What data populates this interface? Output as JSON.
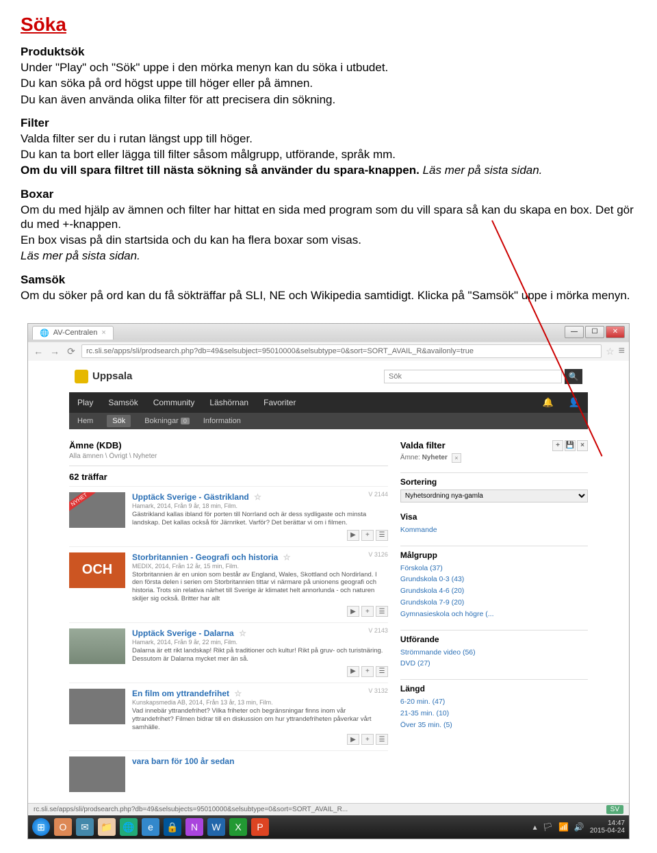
{
  "doc": {
    "title": "Söka",
    "s1": {
      "h": "Produktsök",
      "p1": "Under \"Play\" och \"Sök\" uppe i den mörka menyn kan du söka i utbudet.",
      "p2": "Du kan söka på ord högst uppe till höger eller på ämnen.",
      "p3": "Du kan även använda olika filter för att precisera din sökning."
    },
    "s2": {
      "h": "Filter",
      "p1": "Valda filter ser du i rutan längst upp till höger.",
      "p2": "Du kan ta bort eller lägga till filter såsom målgrupp, utförande, språk mm.",
      "p3bold": "Om du vill spara filtret till nästa sökning så använder du spara-knappen.",
      "p3italic": " Läs mer på sista sidan."
    },
    "s3": {
      "h": "Boxar",
      "p1": "Om du med hjälp av ämnen och filter har hittat en sida med program som du vill spara så kan du skapa en box. Det gör du med +-knappen.",
      "p2": "En box visas på din startsida och du kan ha flera boxar som visas.",
      "p3italic": "Läs mer på sista sidan."
    },
    "s4": {
      "h": "Samsök",
      "p1": "Om du söker på ord kan du få sökträffar på SLI, NE och Wikipedia samtidigt. Klicka på \"Samsök\" uppe i mörka menyn."
    }
  },
  "browser": {
    "tabTitle": "AV-Centralen",
    "url": "rc.sli.se/apps/sli/prodsearch.php?db=49&selsubject=95010000&selsubtype=0&sort=SORT_AVAIL_R&availonly=true"
  },
  "site": {
    "logo": "Uppsala",
    "searchPlaceholder": "Sök",
    "navMain": [
      "Play",
      "Samsök",
      "Community",
      "Läshörnan",
      "Favoriter"
    ],
    "navSub": {
      "hem": "Hem",
      "sok": "Sök",
      "bokningar": "Bokningar",
      "bokCount": "0",
      "info": "Information"
    },
    "left": {
      "panelTitle": "Ämne (KDB)",
      "crumb": "Alla ämnen \\ Övrigt \\ Nyheter",
      "hits": "62 träffar"
    },
    "results": [
      {
        "title": "Upptäck Sverige - Gästrikland",
        "meta": "Hamark, 2014, Från 9 år, 18 min, Film.",
        "desc": "Gästrikland kallas ibland för porten till Norrland och är dess sydligaste och minsta landskap. Det kallas också för Järnriket. Varför? Det berättar vi om i filmen.",
        "id": "V 2144",
        "nyhet": true,
        "thumbClass": ""
      },
      {
        "title": "Storbritannien - Geografi och historia",
        "meta": "MEDIX, 2014, Från 12 år, 15 min, Film.",
        "desc": "Storbritannien är en union som består av England, Wales, Skottland och Nordirland. I den första delen i serien om Storbritannien tittar vi närmare på unionens geografi och historia. Trots sin relativa närhet till Sverige är klimatet helt annorlunda - och naturen skiljer sig också. Britter har allt",
        "id": "V 3126",
        "thumbClass": "och",
        "thumbText": "OCH"
      },
      {
        "title": "Upptäck Sverige - Dalarna",
        "meta": "Hamark, 2014, Från 9 år, 22 min, Film.",
        "desc": "Dalarna är ett rikt landskap! Rikt på traditioner och kultur! Rikt på gruv- och turistnäring. Dessutom är Dalarna mycket mer än så.",
        "id": "V 2143",
        "thumbClass": "gray"
      },
      {
        "title": "En film om yttrandefrihet",
        "meta": "Kunskapsmedia AB, 2014, Från 13 år, 13 min, Film.",
        "desc": "Vad innebär yttrandefrihet? Vilka friheter och begränsningar finns inom vår yttrandefrihet? Filmen bidrar till en diskussion om hur yttrandefriheten påverkar vårt samhälle.",
        "id": "V 3132",
        "thumbClass": ""
      }
    ],
    "right": {
      "valdaFilter": {
        "h": "Valda filter",
        "chipLabel": "Ämne:",
        "chipVal": "Nyheter"
      },
      "sortering": {
        "h": "Sortering",
        "opt": "Nyhetsordning nya-gamla"
      },
      "visa": {
        "h": "Visa",
        "opt": "Kommande"
      },
      "malgrupp": {
        "h": "Målgrupp",
        "items": [
          "Förskola (37)",
          "Grundskola 0-3 (43)",
          "Grundskola 4-6 (20)",
          "Grundskola 7-9 (20)",
          "Gymnasieskola och högre (..."
        ]
      },
      "utforande": {
        "h": "Utförande",
        "items": [
          "Strömmande video (56)",
          "DVD (27)"
        ]
      },
      "langd": {
        "h": "Längd",
        "items": [
          "6-20 min. (47)",
          "21-35 min. (10)",
          "Över 35 min. (5)"
        ]
      }
    },
    "lastResultTitle": "vara barn för 100 år sedan"
  },
  "status": {
    "left": "rc.sli.se/apps/sli/prodsearch.php?db=49&selsubjects=95010000&selsubtype=0&sort=SORT_AVAIL_R...",
    "sync": "SV"
  },
  "taskbar": {
    "time": "14:47",
    "date": "2015-04-24"
  }
}
